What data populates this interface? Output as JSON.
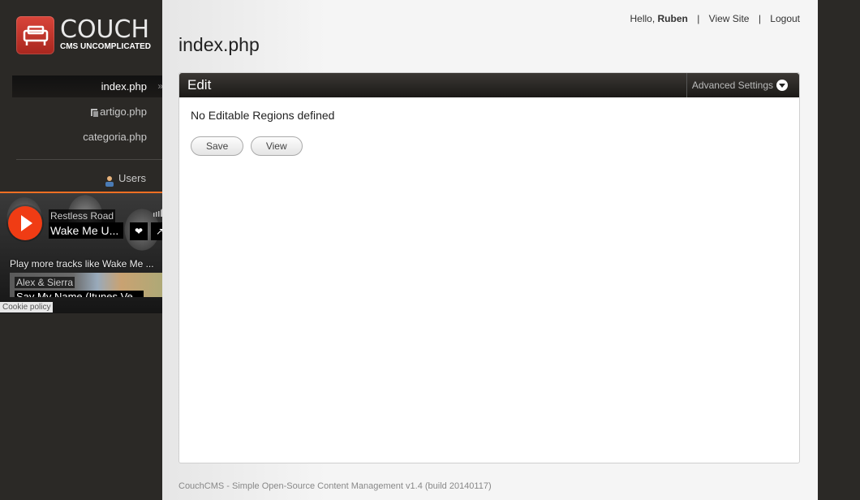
{
  "logo": {
    "title": "COUCH",
    "tagline": "CMS UNCOMPLICATED"
  },
  "sidebar": {
    "items": [
      {
        "label": "index.php"
      },
      {
        "label": "artigo.php"
      },
      {
        "label": "categoria.php"
      }
    ],
    "users_label": "Users"
  },
  "soundcloud": {
    "artist": "Restless Road",
    "track": "Wake Me U...",
    "more_text": "Play more tracks like Wake Me ...",
    "next_artist": "Alex & Sierra",
    "next_track": "Say My Name (Itunes Ve..."
  },
  "cookie_policy": "Cookie policy",
  "topnav": {
    "hello": "Hello,",
    "user": "Ruben",
    "view_site": "View Site",
    "logout": "Logout"
  },
  "page_title": "index.php",
  "panel": {
    "title": "Edit",
    "advanced": "Advanced Settings",
    "message": "No Editable Regions defined",
    "save": "Save",
    "view": "View"
  },
  "footer": "CouchCMS - Simple Open-Source Content Management v1.4 (build 20140117)",
  "colors": {
    "accent": "#f26f23",
    "sidebar": "#2b2926",
    "logo_red": "#c9342a"
  }
}
